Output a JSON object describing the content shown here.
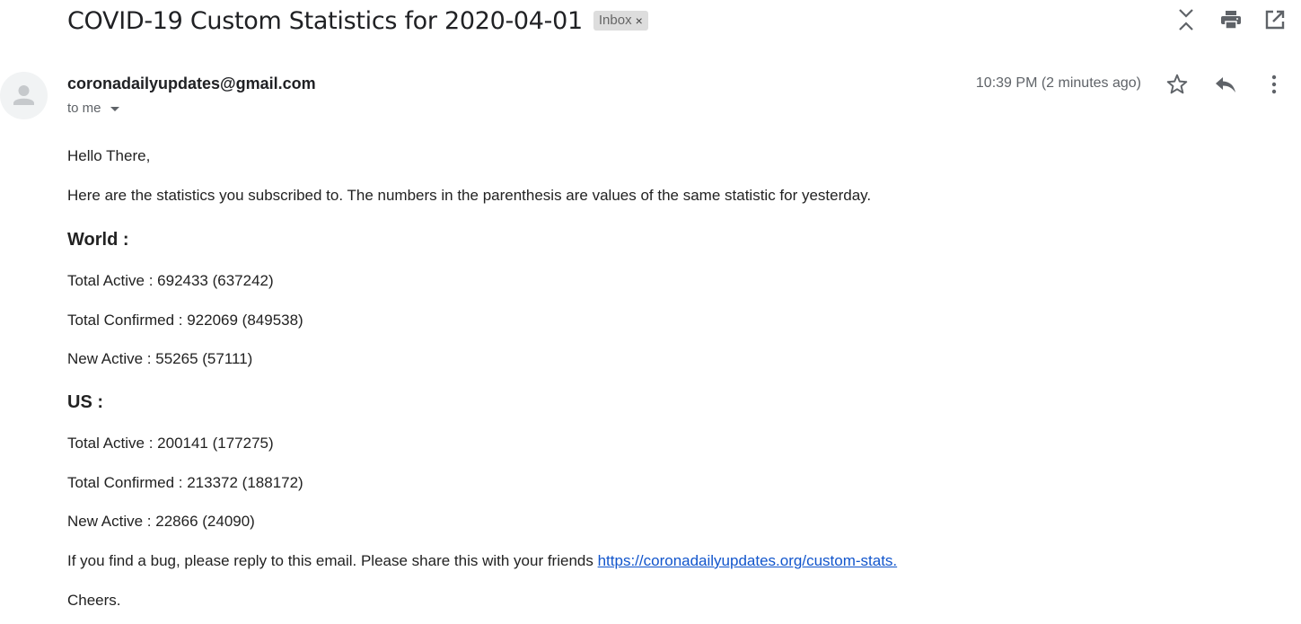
{
  "email": {
    "subject": "COVID-19 Custom Statistics for 2020-04-01",
    "label_chip": "Inbox",
    "label_chip_close": "×",
    "sender": "coronadailyupdates@gmail.com",
    "recipient_label": "to me",
    "timestamp": "10:39 PM (2 minutes ago)"
  },
  "body": {
    "greeting": "Hello There,",
    "intro": "Here are the statistics you subscribed to. The numbers in the parenthesis are values of the same statistic for yesterday.",
    "sections": [
      {
        "heading": "World :",
        "lines": [
          "Total Active : 692433 (637242)",
          "Total Confirmed : 922069 (849538)",
          "New Active : 55265 (57111)"
        ]
      },
      {
        "heading": "US :",
        "lines": [
          "Total Active : 200141 (177275)",
          "Total Confirmed : 213372 (188172)",
          "New Active : 22866 (24090)"
        ]
      }
    ],
    "footer_text": "If you find a bug, please reply to this email. Please share this with your friends ",
    "footer_link": "https://coronadailyupdates.org/custom-stats.",
    "signoff": "Cheers."
  },
  "icons": {
    "collapse": "collapse-all-icon",
    "print": "print-icon",
    "open_new_window": "open-in-new-window-icon",
    "star": "star-icon",
    "reply": "reply-icon",
    "more": "more-vertical-icon",
    "avatar": "person-avatar-icon"
  },
  "colors": {
    "link": "#1155cc",
    "chip_bg": "#dddddd",
    "secondary_text": "#5f6368",
    "icon": "#5f6368"
  }
}
